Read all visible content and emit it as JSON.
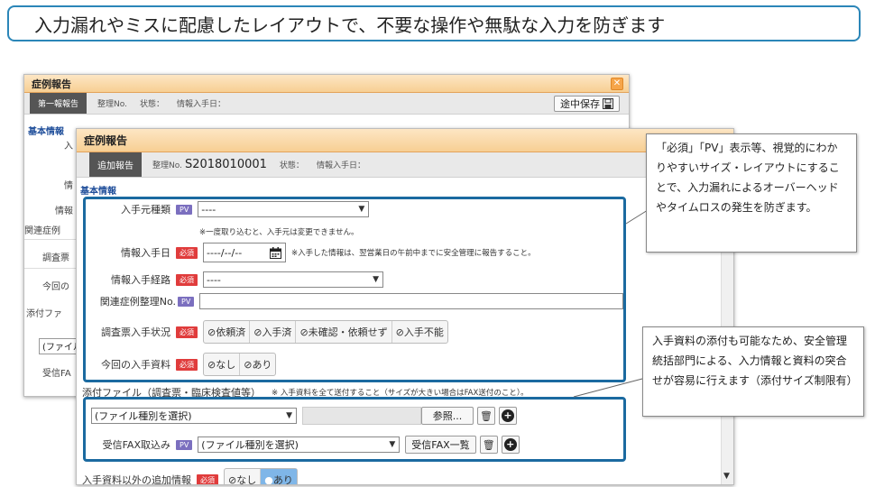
{
  "banner": {
    "text": "入力漏れやミスに配慮したレイアウトで、不要な操作や無駄な入力を防ぎます"
  },
  "back_window": {
    "title": "症例報告",
    "tab": "第一報報告",
    "meta": [
      "整理No.",
      "状態：",
      "情報入手日："
    ],
    "save_label": "途中保存",
    "section": "基本情報",
    "side_labels": [
      "入",
      "情",
      "情報",
      "関連症例",
      "調査票",
      "今回の",
      "添付ファ",
      "受信FA"
    ],
    "select_value": "(ファイル"
  },
  "front_window": {
    "title": "症例報告",
    "tab": "追加報告",
    "meta": {
      "seiri_label": "整理No.",
      "seiri_value": "S2018010001",
      "status": "状態：",
      "date": "情報入手日："
    },
    "section": "基本情報",
    "badges": {
      "pv": "PV",
      "required": "必須"
    },
    "fields": {
      "source_type": {
        "label": "入手元種類",
        "value": "----",
        "note": "※一度取り込むと、入手元は変更できません。"
      },
      "info_date": {
        "label": "情報入手日",
        "value": "----/--/--",
        "note": "※入手した情報は、翌営業日の午前中までに安全管理に報告すること。"
      },
      "route": {
        "label": "情報入手経路",
        "value": "----"
      },
      "related_no": {
        "label": "関連症例整理No.",
        "value": ""
      },
      "survey_status": {
        "label": "調査票入手状況",
        "options": [
          "依頼済",
          "入手済",
          "未確認・依頼せず",
          "入手不能"
        ]
      },
      "this_material": {
        "label": "今回の入手資料",
        "options": [
          "なし",
          "あり"
        ]
      }
    },
    "attach": {
      "heading": "添付ファイル（調査票・臨床検査値等）",
      "heading_note": "※ 入手資料を全て送付すること（サイズが大きい場合はFAX送付のこと）。",
      "file_type": "(ファイル種別を選択)",
      "browse": "参照...",
      "fax_label": "受信FAX取込み",
      "fax_file_type": "(ファイル種別を選択)",
      "fax_list": "受信FAX一覧"
    },
    "extra": {
      "label": "入手資料以外の追加情報",
      "options": [
        "なし",
        "あり"
      ]
    }
  },
  "callouts": {
    "top": "「必須」「PV」表示等、視覚的にわかりやすいサイズ・レイアウトにすることで、入力漏れによるオーバーヘッドやタイムロスの発生を防ぎます。",
    "bottom": "入手資料の添付も可能なため、安全管理統括部門による、入力情報と資料の突合せが容易に行えます（添付サイズ制限有）"
  },
  "icons": [
    "save-icon",
    "calendar-icon",
    "chevron-down-icon",
    "trash-icon",
    "plus-circle-icon",
    "check-circle-icon",
    "close-icon"
  ],
  "colors": {
    "accent_blue": "#1b6aa0",
    "pv_badge": "#7b6fbf",
    "required_badge": "#e03c3c",
    "titlebar": "#f7cf93"
  }
}
